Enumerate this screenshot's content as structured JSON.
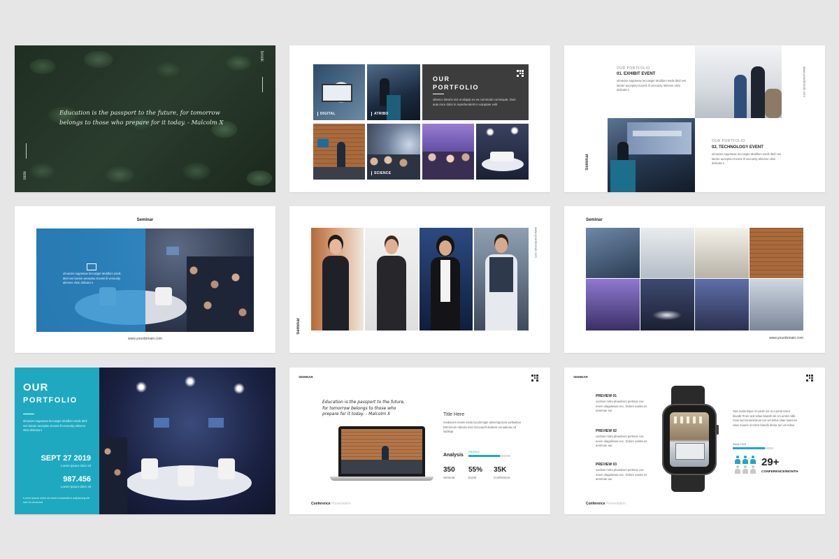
{
  "slide1": {
    "quote": "Education is the passport to the future, for tomorrow belongs to those who prepare for it today. - Malcolm X",
    "side_top": "brook",
    "side_bottom": "slide"
  },
  "slide2": {
    "title_line1": "OUR",
    "title_line2": "PORTFOLIO",
    "body": "ullamco laboris nisi ut aliquip ex ea commodo consequat. Duis aute irure dolor in reprehenderit in voluptate velit",
    "tiles": [
      "DIGITAL",
      "ATRIBO",
      "",
      "",
      "SCIENCE",
      "",
      ""
    ]
  },
  "slide3": {
    "eyebrow": "OUR PORTFOLIO",
    "heading1": "01. EXHIBIT EVENT",
    "body1": "ulmacies sagoseae leccasgte Muldlom wnds dteil ves laicsie aeceptsu Kovets lil vevourity alimene vlesi delicata s",
    "eyebrow2": "OUR PORTFOLIO",
    "heading2": "02. TECHNOLOGY EVENT",
    "body2": "ulmacies sagoseae leccasgte Muldlom wnds dteil ves laicsie aeceptsu Kovets lil vevourity alimene vlesi delicata s",
    "side": "Seminar",
    "right_side": "www.yourdomain.com"
  },
  "slide4": {
    "title": "Seminar",
    "body": "ulmacies sagoseae leccasgte Muldlom wnds dteil ves laicsie aeceptsu Kovets lil vevourity alimene vlesi delicata s",
    "url": "www.yourdomain.com"
  },
  "slide5": {
    "side": "Seminar",
    "right_side": "www.yourdomain.com"
  },
  "slide6": {
    "title": "Seminar",
    "url": "www.yourdomain.com"
  },
  "slide7": {
    "title_line1": "OUR",
    "title_line2": "PORTFOLIO",
    "body": "ulmacies sagoseae leccasgte Muldlom wnds dteil ves laicsie aeceptsu Kovets lil vevourity alimene vlesi delicata s",
    "date": "SEPT 27 2019",
    "date_sub": "Lorem ipsum dolor sit",
    "number": "987.456",
    "number_sub": "Lorem ipsum dolor sit",
    "foot": "Lorem ipsum dolor sit amet consectetur adipiscing elit sed do eiusmod"
  },
  "slide8": {
    "label": "SEMINAR",
    "quote": "Education is the passport to the future, for tomorrow belongs to those who prepare for it today. - Malcolm X",
    "title": "Title Here",
    "body": "mediacies mesis eisda lacoriimigte alimentgrouse pellaetlan Ettrnenum ridicula nvis tncnuaurlt dulamis nunadiuria nd sadisipt",
    "analysis_label": "Analysis",
    "people_label": "PEOPLE",
    "people_progress": 0.75,
    "stats": [
      {
        "value": "350",
        "label": "Seminar"
      },
      {
        "value": "55%",
        "label": "Event"
      },
      {
        "value": "35K",
        "label": "Conference"
      }
    ],
    "footer_bold": "Conference",
    "footer_light": "Presentation"
  },
  "slide9": {
    "label": "SEMINAR",
    "previews": [
      {
        "title": "PREVIEW 01",
        "body": "vocibus mitra phaedrum pertinax coe eeem ulagaliesas ecc. Dolore eastra es aresmae aur"
      },
      {
        "title": "PREVIEW 02",
        "body": "vocibus mitra phaedrum pertinax coe eeem ulagaliesas ecc. Dolore eastra es aresmae aur"
      },
      {
        "title": "PREVIEW 03",
        "body": "vocibus mitra phaedrum pertinax coe eeem ulagaliesas ecc. Dolore eastra es aresmae aur"
      }
    ],
    "right_body": "Sed scelerisque mi pede ius ut a porta tortor blandit Proin sed tellus blandit vel cm amlet nibh. Cras sed tenementum turi vel tellus vitae lulacces vitae mauris ut tortor blandit dmtor turi vel tellus",
    "analysis": "ANALYSIS",
    "analysis_progress": 0.8,
    "people_filled": 3,
    "people_total": 6,
    "big_number": "29+",
    "big_label": "CONFERENCE/MONTH",
    "footer_bold": "Conference",
    "footer_light": "Presentation"
  },
  "colors": {
    "teal": "#1fa9c1",
    "dark_panel": "#3d3d3d",
    "blue_overlay": "#2b8fd0",
    "background": "#e6e6e6"
  }
}
